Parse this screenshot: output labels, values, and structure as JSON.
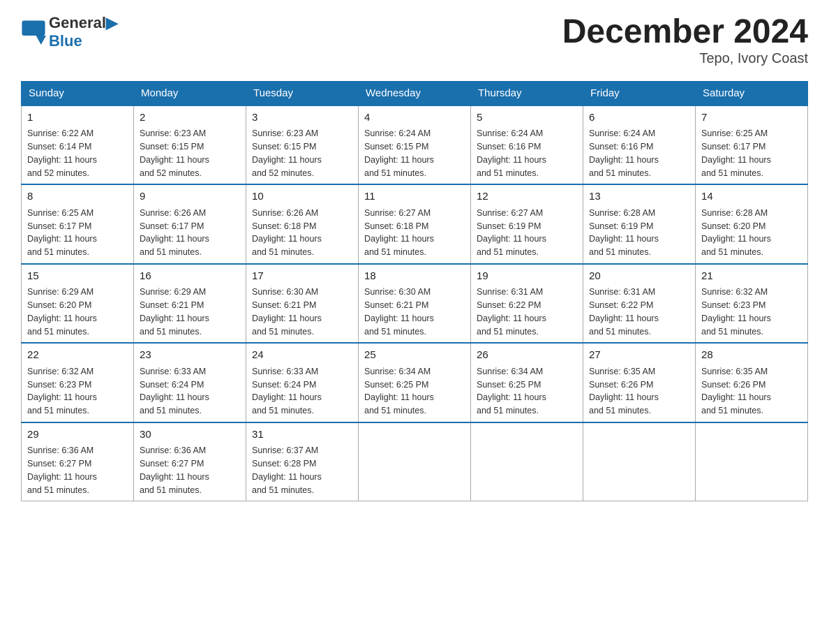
{
  "logo": {
    "text_general": "General",
    "text_blue": "Blue"
  },
  "title": "December 2024",
  "subtitle": "Tepo, Ivory Coast",
  "days_of_week": [
    "Sunday",
    "Monday",
    "Tuesday",
    "Wednesday",
    "Thursday",
    "Friday",
    "Saturday"
  ],
  "weeks": [
    [
      {
        "day": "1",
        "sunrise": "6:22 AM",
        "sunset": "6:14 PM",
        "daylight": "11 hours and 52 minutes."
      },
      {
        "day": "2",
        "sunrise": "6:23 AM",
        "sunset": "6:15 PM",
        "daylight": "11 hours and 52 minutes."
      },
      {
        "day": "3",
        "sunrise": "6:23 AM",
        "sunset": "6:15 PM",
        "daylight": "11 hours and 52 minutes."
      },
      {
        "day": "4",
        "sunrise": "6:24 AM",
        "sunset": "6:15 PM",
        "daylight": "11 hours and 51 minutes."
      },
      {
        "day": "5",
        "sunrise": "6:24 AM",
        "sunset": "6:16 PM",
        "daylight": "11 hours and 51 minutes."
      },
      {
        "day": "6",
        "sunrise": "6:24 AM",
        "sunset": "6:16 PM",
        "daylight": "11 hours and 51 minutes."
      },
      {
        "day": "7",
        "sunrise": "6:25 AM",
        "sunset": "6:17 PM",
        "daylight": "11 hours and 51 minutes."
      }
    ],
    [
      {
        "day": "8",
        "sunrise": "6:25 AM",
        "sunset": "6:17 PM",
        "daylight": "11 hours and 51 minutes."
      },
      {
        "day": "9",
        "sunrise": "6:26 AM",
        "sunset": "6:17 PM",
        "daylight": "11 hours and 51 minutes."
      },
      {
        "day": "10",
        "sunrise": "6:26 AM",
        "sunset": "6:18 PM",
        "daylight": "11 hours and 51 minutes."
      },
      {
        "day": "11",
        "sunrise": "6:27 AM",
        "sunset": "6:18 PM",
        "daylight": "11 hours and 51 minutes."
      },
      {
        "day": "12",
        "sunrise": "6:27 AM",
        "sunset": "6:19 PM",
        "daylight": "11 hours and 51 minutes."
      },
      {
        "day": "13",
        "sunrise": "6:28 AM",
        "sunset": "6:19 PM",
        "daylight": "11 hours and 51 minutes."
      },
      {
        "day": "14",
        "sunrise": "6:28 AM",
        "sunset": "6:20 PM",
        "daylight": "11 hours and 51 minutes."
      }
    ],
    [
      {
        "day": "15",
        "sunrise": "6:29 AM",
        "sunset": "6:20 PM",
        "daylight": "11 hours and 51 minutes."
      },
      {
        "day": "16",
        "sunrise": "6:29 AM",
        "sunset": "6:21 PM",
        "daylight": "11 hours and 51 minutes."
      },
      {
        "day": "17",
        "sunrise": "6:30 AM",
        "sunset": "6:21 PM",
        "daylight": "11 hours and 51 minutes."
      },
      {
        "day": "18",
        "sunrise": "6:30 AM",
        "sunset": "6:21 PM",
        "daylight": "11 hours and 51 minutes."
      },
      {
        "day": "19",
        "sunrise": "6:31 AM",
        "sunset": "6:22 PM",
        "daylight": "11 hours and 51 minutes."
      },
      {
        "day": "20",
        "sunrise": "6:31 AM",
        "sunset": "6:22 PM",
        "daylight": "11 hours and 51 minutes."
      },
      {
        "day": "21",
        "sunrise": "6:32 AM",
        "sunset": "6:23 PM",
        "daylight": "11 hours and 51 minutes."
      }
    ],
    [
      {
        "day": "22",
        "sunrise": "6:32 AM",
        "sunset": "6:23 PM",
        "daylight": "11 hours and 51 minutes."
      },
      {
        "day": "23",
        "sunrise": "6:33 AM",
        "sunset": "6:24 PM",
        "daylight": "11 hours and 51 minutes."
      },
      {
        "day": "24",
        "sunrise": "6:33 AM",
        "sunset": "6:24 PM",
        "daylight": "11 hours and 51 minutes."
      },
      {
        "day": "25",
        "sunrise": "6:34 AM",
        "sunset": "6:25 PM",
        "daylight": "11 hours and 51 minutes."
      },
      {
        "day": "26",
        "sunrise": "6:34 AM",
        "sunset": "6:25 PM",
        "daylight": "11 hours and 51 minutes."
      },
      {
        "day": "27",
        "sunrise": "6:35 AM",
        "sunset": "6:26 PM",
        "daylight": "11 hours and 51 minutes."
      },
      {
        "day": "28",
        "sunrise": "6:35 AM",
        "sunset": "6:26 PM",
        "daylight": "11 hours and 51 minutes."
      }
    ],
    [
      {
        "day": "29",
        "sunrise": "6:36 AM",
        "sunset": "6:27 PM",
        "daylight": "11 hours and 51 minutes."
      },
      {
        "day": "30",
        "sunrise": "6:36 AM",
        "sunset": "6:27 PM",
        "daylight": "11 hours and 51 minutes."
      },
      {
        "day": "31",
        "sunrise": "6:37 AM",
        "sunset": "6:28 PM",
        "daylight": "11 hours and 51 minutes."
      },
      null,
      null,
      null,
      null
    ]
  ],
  "labels": {
    "sunrise": "Sunrise:",
    "sunset": "Sunset:",
    "daylight": "Daylight:"
  }
}
